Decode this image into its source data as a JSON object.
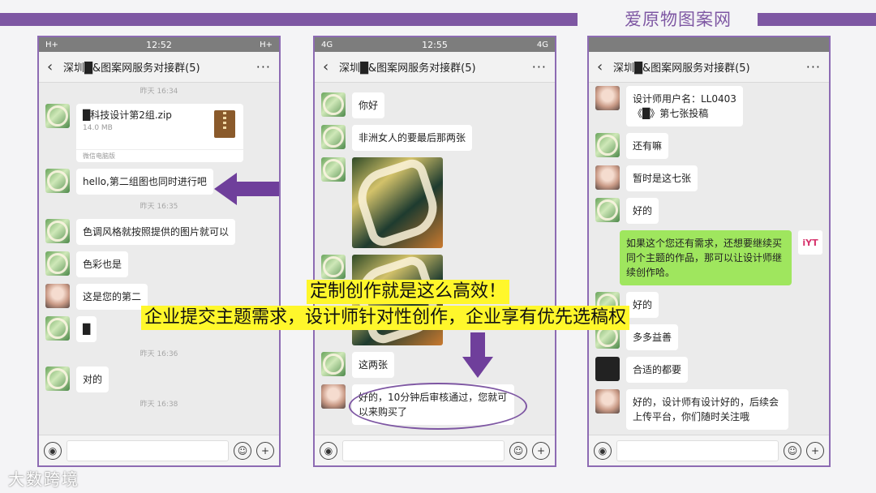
{
  "brand": "爱原物图案网",
  "watermark": "大数跨境",
  "colors": {
    "accent": "#7e57a3",
    "highlight": "#fff72b",
    "bubble_green": "#9fe65e"
  },
  "phone1": {
    "status": {
      "left": "H+",
      "time": "12:52",
      "right": "H+"
    },
    "title": "深圳█&图案网服务对接群(5)",
    "timestamps": [
      "昨天 16:34",
      "昨天 16:35",
      "昨天 16:36",
      "昨天 16:38"
    ],
    "file": {
      "name": "█科技设计第2组.zip",
      "size": "14.0 MB",
      "source": "微信电脑版"
    },
    "msg1": "hello,第二组图也同时进行吧",
    "msg2": "色调风格就按照提供的图片就可以",
    "msg3": "色彩也是",
    "msg4": "这是您的第二",
    "msg5": "█",
    "msg6": "对的"
  },
  "phone2": {
    "status": {
      "left": "4G",
      "time": "12:55",
      "right": "4G"
    },
    "title": "深圳█&图案网服务对接群(5)",
    "msg1": "你好",
    "msg2": "非洲女人的要最后那两张",
    "msg3": "这两张",
    "msg4": "好的，10分钟后审核通过，您就可以来购买了"
  },
  "phone3": {
    "title": "深圳█&图案网服务对接群(5)",
    "msg1": "设计师用户名：LL0403\n《█》第七张投稿",
    "msg2": "还有嘛",
    "msg3": "暂时是这七张",
    "msg4": "好的",
    "msg5": "如果这个您还有需求，还想要继续买同个主题的作品，那可以让设计师继续创作哈。",
    "msg6": "好的",
    "msg7": "多多益善",
    "msg8": "合适的都要",
    "msg9": "好的，设计师有设计好的，后续会上传平台，你们随时关注哦"
  },
  "banner": {
    "line1": "定制创作就是这么高效！",
    "line2": "企业提交主题需求，设计师针对性创作，企业享有优先选稿权"
  },
  "icons": {
    "back": "chevron-left-icon",
    "more": "more-icon",
    "voice": "voice-icon",
    "emoji": "emoji-icon",
    "plus": "plus-icon"
  }
}
